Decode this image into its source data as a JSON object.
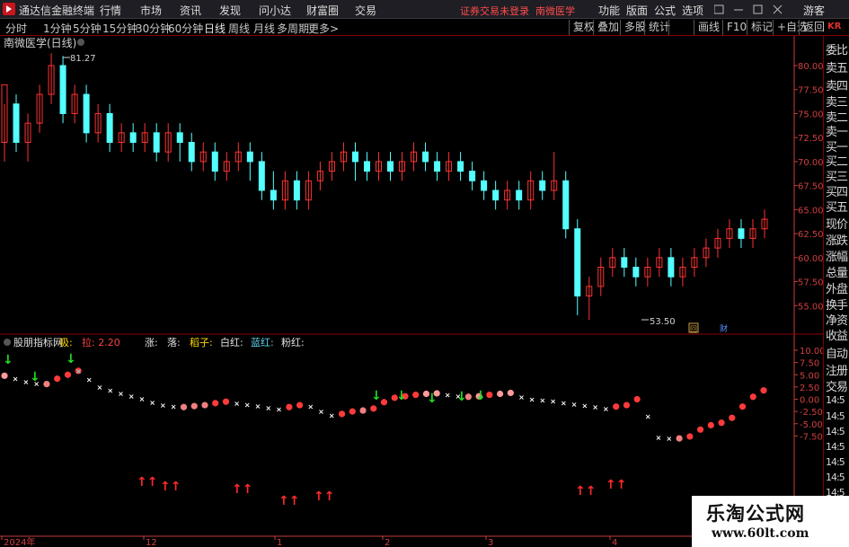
{
  "app": {
    "title": "通达信金融终端",
    "menu": [
      "行情",
      "市场",
      "资讯",
      "发现",
      "问小达",
      "财富圈",
      "交易"
    ],
    "notice": "证券交易未登录",
    "stock_name": "南微医学",
    "right_menu": [
      "功能",
      "版面",
      "公式",
      "选项"
    ],
    "guest": "游客"
  },
  "period": {
    "tabs": [
      "分时",
      "1分钟",
      "5分钟",
      "15分钟",
      "30分钟",
      "60分钟",
      "日线",
      "周线",
      "月线",
      "多周期",
      "更多"
    ],
    "active": "日线",
    "buttons": [
      "复权",
      "叠加",
      "多股",
      "统计",
      "画线",
      "F10",
      "标记",
      "+自选",
      "返回"
    ]
  },
  "chart": {
    "title": "南微医学(日线)",
    "high_label": "81.27",
    "low_label": "53.50",
    "price_ticks": [
      "80.00",
      "77.50",
      "75.00",
      "72.50",
      "70.00",
      "67.50",
      "65.00",
      "62.50",
      "60.00",
      "57.50",
      "55.00"
    ],
    "indicator": {
      "name": "股朋指标网",
      "items": [
        {
          "label": "吸",
          "value": "",
          "color": "#ffd700"
        },
        {
          "label": "拉",
          "value": "2.20",
          "color": "#ff4040"
        },
        {
          "label": "涨",
          "value": "",
          "color": "#e0e0e0"
        },
        {
          "label": "落",
          "value": "",
          "color": "#e0e0e0"
        },
        {
          "label": "稻子",
          "value": "",
          "color": "#ffd700"
        },
        {
          "label": "白红",
          "value": "",
          "color": "#e0e0e0"
        },
        {
          "label": "蓝红",
          "value": "",
          "color": "#5bd0e6"
        },
        {
          "label": "粉红",
          "value": "",
          "color": "#e0e0e0"
        }
      ]
    },
    "ind_ticks": [
      "10.00",
      "7.50",
      "5.00",
      "2.50",
      "0.00",
      "-2.50",
      "-5.00",
      "-7.50"
    ],
    "date_labels": [
      "2024年",
      "12",
      "1",
      "2",
      "3",
      "4"
    ],
    "badges": [
      "回",
      "财"
    ],
    "colors": {
      "up": "#ff3232",
      "down": "#54ffff",
      "axis": "#c83c3c"
    }
  },
  "right_panel": [
    "委比",
    "卖五",
    "卖四",
    "卖三",
    "卖二",
    "卖一",
    "买一",
    "买二",
    "买三",
    "买四",
    "买五",
    "现价",
    "涨跌",
    "涨幅",
    "总量",
    "外盘",
    "换手",
    "净资",
    "收益"
  ],
  "right_panel_lower": [
    "自动",
    "注册",
    "交易"
  ],
  "right_panel_times": [
    "14:5",
    "14:5",
    "14:5",
    "14:5",
    "14:5",
    "14:5",
    "14:5"
  ],
  "kr": "KR",
  "watermark": {
    "line1": "乐淘公式网",
    "line2": "www.60lt.com"
  }
}
